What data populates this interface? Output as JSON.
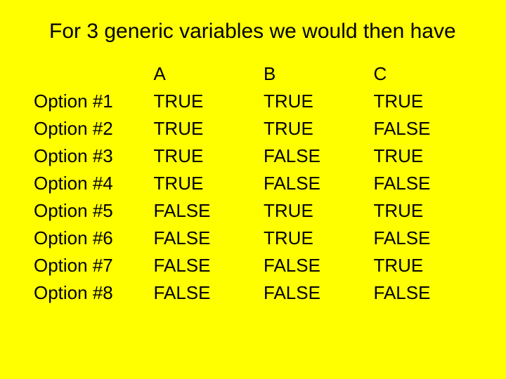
{
  "title": "For 3 generic variables we would then have",
  "chart_data": {
    "type": "table",
    "columns": [
      "",
      "A",
      "B",
      "C"
    ],
    "rows": [
      {
        "label": "Option #1",
        "values": [
          "TRUE",
          "TRUE",
          "TRUE"
        ]
      },
      {
        "label": "Option #2",
        "values": [
          "TRUE",
          "TRUE",
          "FALSE"
        ]
      },
      {
        "label": "Option #3",
        "values": [
          "TRUE",
          "FALSE",
          "TRUE"
        ]
      },
      {
        "label": "Option #4",
        "values": [
          "TRUE",
          "FALSE",
          "FALSE"
        ]
      },
      {
        "label": "Option #5",
        "values": [
          "FALSE",
          "TRUE",
          "TRUE"
        ]
      },
      {
        "label": "Option #6",
        "values": [
          "FALSE",
          "TRUE",
          "FALSE"
        ]
      },
      {
        "label": "Option #7",
        "values": [
          "FALSE",
          "FALSE",
          "TRUE"
        ]
      },
      {
        "label": "Option #8",
        "values": [
          "FALSE",
          "FALSE",
          "FALSE"
        ]
      }
    ]
  }
}
